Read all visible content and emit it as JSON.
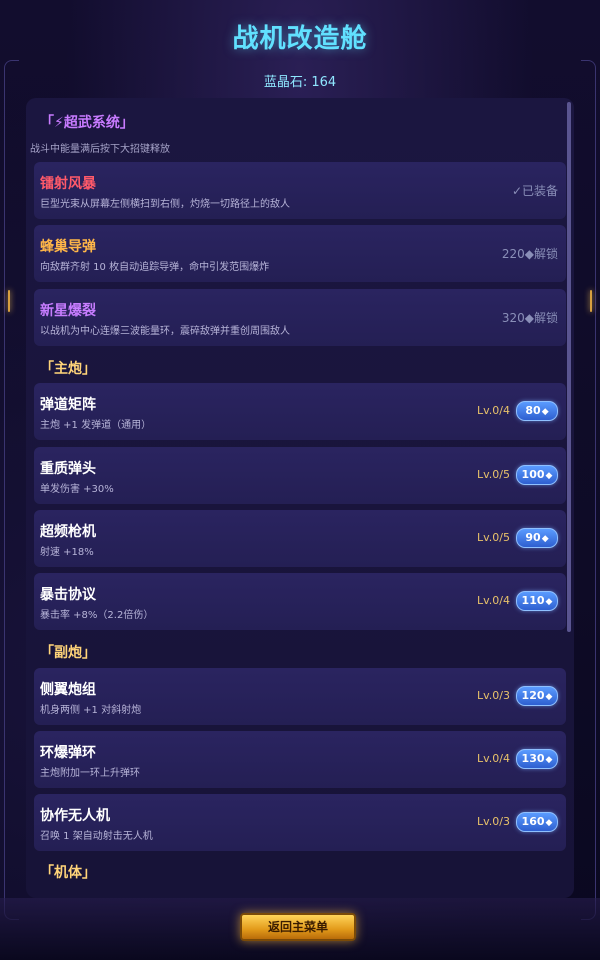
{
  "header": {
    "title": "战机改造舱",
    "gems_label": "蓝晶石: 164"
  },
  "sections": {
    "super": {
      "title": "「⚡超武系统」",
      "subtitle": "战斗中能量满后按下大招键释放"
    },
    "main": {
      "title": "「主炮」"
    },
    "sub": {
      "title": "「副炮」"
    },
    "body": {
      "title": "「机体」"
    }
  },
  "super_items": [
    {
      "name": "镭射风暴",
      "desc": "巨型光束从屏幕左侧横扫到右侧，灼烧一切路径上的敌人",
      "state": "✓已装备"
    },
    {
      "name": "蜂巢导弹",
      "desc": "向敌群齐射 10 枚自动追踪导弹，命中引发范围爆炸",
      "state": "220◆解锁"
    },
    {
      "name": "新星爆裂",
      "desc": "以战机为中心连爆三波能量环，震碎敌弹并重创周围敌人",
      "state": "320◆解锁"
    }
  ],
  "main_items": [
    {
      "name": "弹道矩阵",
      "desc": "主炮 +1 发弹道（通用）",
      "level": "Lv.0/4",
      "cost": "80"
    },
    {
      "name": "重质弹头",
      "desc": "单发伤害 +30%",
      "level": "Lv.0/5",
      "cost": "100"
    },
    {
      "name": "超频枪机",
      "desc": "射速 +18%",
      "level": "Lv.0/5",
      "cost": "90"
    },
    {
      "name": "暴击协议",
      "desc": "暴击率 +8%（2.2倍伤）",
      "level": "Lv.0/4",
      "cost": "110"
    }
  ],
  "sub_items": [
    {
      "name": "侧翼炮组",
      "desc": "机身两侧 +1 对斜射炮",
      "level": "Lv.0/3",
      "cost": "120"
    },
    {
      "name": "环爆弹环",
      "desc": "主炮附加一环上升弹环",
      "level": "Lv.0/4",
      "cost": "130"
    },
    {
      "name": "协作无人机",
      "desc": "召唤 1 架自动射击无人机",
      "level": "Lv.0/3",
      "cost": "160"
    }
  ],
  "footer": {
    "menu_label": "返回主菜单"
  },
  "colors": {
    "accent": "#61e1ff",
    "gold": "#ffd479",
    "super": "#c87bff"
  }
}
